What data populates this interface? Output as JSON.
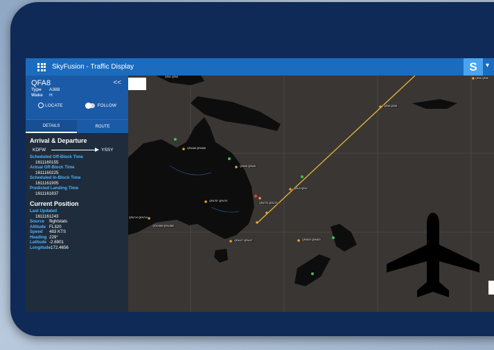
{
  "app": {
    "title": "SkyFusion - Traffic Display",
    "brand_letter": "S"
  },
  "flight": {
    "callsign": "QFA8",
    "type_label": "Type",
    "type_value": "A388",
    "wake_label": "Wake",
    "wake_value": "H",
    "locate_label": "LOCATE",
    "follow_label": "FOLLOW",
    "collapse_glyph": "<<"
  },
  "tabs": [
    {
      "label": "DETAILS",
      "active": true
    },
    {
      "label": "ROUTE",
      "active": false
    }
  ],
  "arrival_departure": {
    "title": "Arrival & Departure",
    "origin": "KDFW",
    "destination": "YSSY",
    "fields": [
      {
        "label": "Scheduled Off-Block Time",
        "value": "1611160155"
      },
      {
        "label": "Actual Off-Block Time",
        "value": "1611160225"
      },
      {
        "label": "Scheduled In-Block Time",
        "value": "1611161905"
      },
      {
        "label": "Predicted Landing Time",
        "value": "1611161837"
      }
    ]
  },
  "current_position": {
    "title": "Current Position",
    "last_updated_label": "Last Updated",
    "last_updated_value": "1611161243",
    "rows": [
      {
        "label": "Source",
        "value": "flightstats"
      },
      {
        "label": "Altitude",
        "value": "FL320"
      },
      {
        "label": "Speed",
        "value": "483 KTS"
      },
      {
        "label": "Heading",
        "value": "229°"
      },
      {
        "label": "Latitude",
        "value": "-2.6901"
      },
      {
        "label": "Longitude",
        "value": "-172.4656"
      }
    ]
  },
  "map": {
    "route_color": "#e0b13a",
    "land_color": "#0d0d0d",
    "labels": [
      "QFA1 QFA9",
      "QFA436 QFA608",
      "QFA8 QFA8",
      "QFA25 QFA25",
      "QFA 8 QFA2",
      "QFA757 QFA757",
      "QFA723 QFA723",
      "QFA719 QFA719",
      "QFA523 QFA523",
      "QFA127 QFA127",
      "QFA1568 QFA1568",
      "QFA5 QFA5"
    ]
  },
  "icons": {
    "menu": "grid-menu-icon",
    "plane": "airplane-icon",
    "locate": "crosshair-icon"
  },
  "colors": {
    "frame": "#0f2a56",
    "topbar": "#1b6cbf",
    "sidebar": "#1f2c3b",
    "accent_label": "#4fb3ff"
  }
}
